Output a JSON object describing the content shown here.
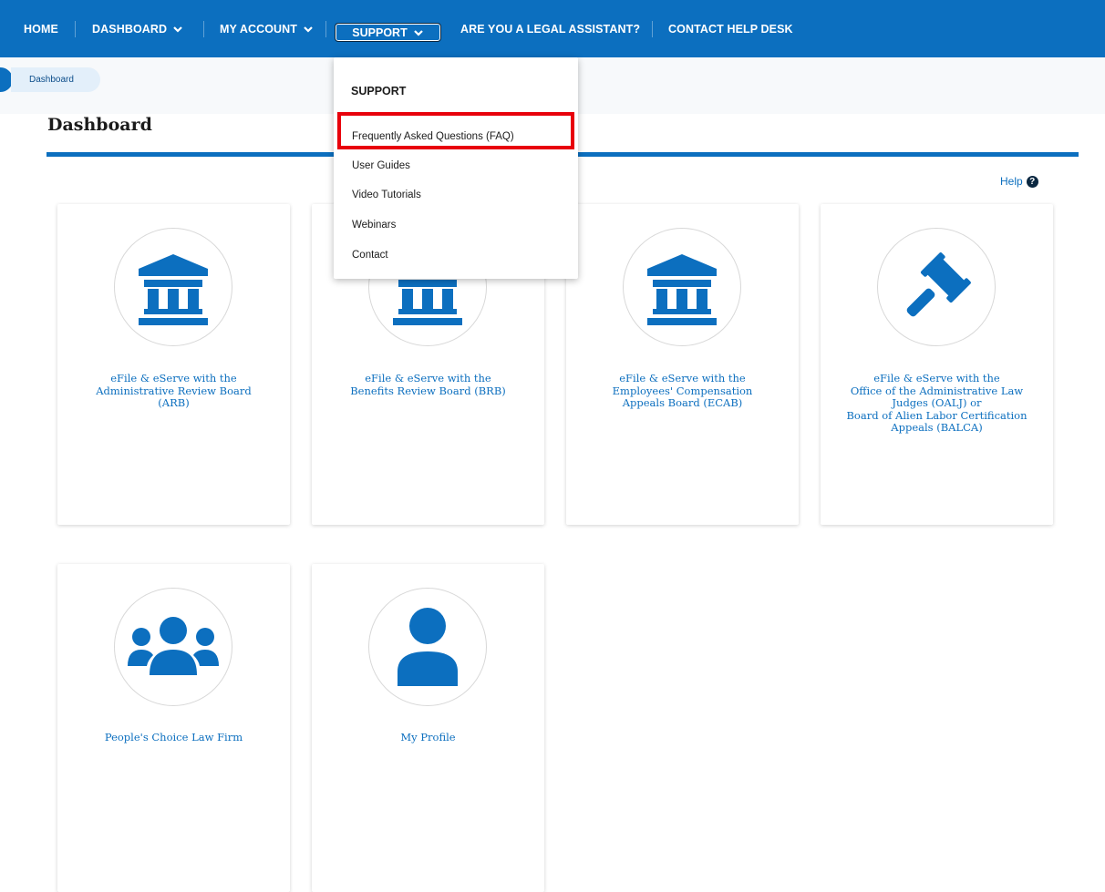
{
  "nav": {
    "home": "HOME",
    "dashboard": "DASHBOARD",
    "my_account": "MY ACCOUNT",
    "support": "SUPPORT",
    "legal_assistant": "ARE YOU A LEGAL ASSISTANT?",
    "help_desk": "CONTACT HELP DESK"
  },
  "breadcrumb": {
    "current": "Dashboard"
  },
  "page": {
    "title": "Dashboard",
    "help": "Help"
  },
  "support_menu": {
    "heading": "SUPPORT",
    "items": [
      "Frequently Asked Questions (FAQ)",
      "User Guides",
      "Video Tutorials",
      "Webinars",
      "Contact"
    ]
  },
  "cards": [
    {
      "icon": "building-icon",
      "lines": [
        "eFile & eServe with the",
        "Administrative Review Board",
        "(ARB)"
      ]
    },
    {
      "icon": "building-icon",
      "lines": [
        "eFile & eServe with the",
        "Benefits Review Board (BRB)"
      ]
    },
    {
      "icon": "building-icon",
      "lines": [
        "eFile & eServe with the",
        "Employees' Compensation",
        "Appeals Board (ECAB)"
      ]
    },
    {
      "icon": "gavel-icon",
      "lines": [
        "eFile & eServe with the",
        "Office of the Administrative Law",
        "Judges (OALJ) or",
        "Board of Alien Labor Certification",
        "Appeals (BALCA)"
      ]
    },
    {
      "icon": "group-icon",
      "lines": [
        "People's Choice Law Firm"
      ]
    },
    {
      "icon": "user-icon",
      "lines": [
        "My Profile"
      ]
    }
  ],
  "colors": {
    "brand": "#0c6fbf",
    "highlight": "#e8000b"
  }
}
